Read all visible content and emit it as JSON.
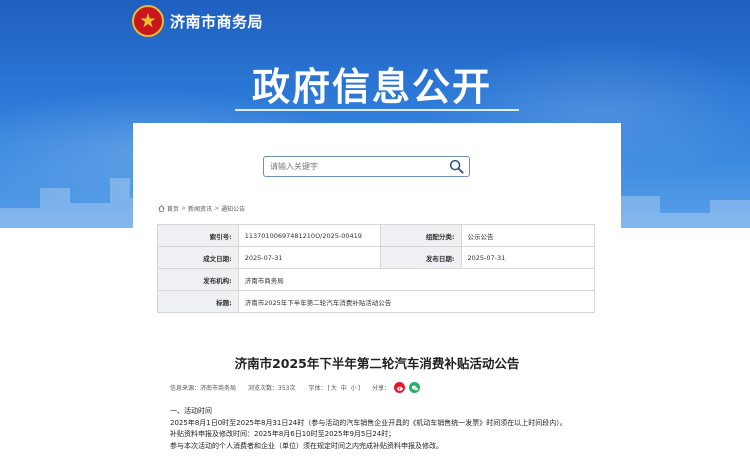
{
  "site": {
    "name": "济南市商务局",
    "banner_title": "政府信息公开"
  },
  "search": {
    "placeholder": "请输入关键字",
    "value": ""
  },
  "breadcrumb": {
    "items": [
      "首页",
      "新闻资讯",
      "通知公告"
    ]
  },
  "meta": {
    "index_label": "索引号:",
    "index_value": "11370100697481210O/2025-00419",
    "category_label": "组配分类:",
    "category_value": "公示公告",
    "created_label": "成文日期:",
    "created_value": "2025-07-31",
    "published_label": "发布日期:",
    "published_value": "2025-07-31",
    "issuer_label": "发布机构:",
    "issuer_value": "济南市商务局",
    "title_label": "标题:",
    "title_value": "济南市2025年下半年第二轮汽车消费补贴活动公告"
  },
  "article": {
    "title": "济南市2025年下半年第二轮汽车消费补贴活动公告",
    "source": "信息来源：济南市商务局",
    "views": "浏览次数：353次",
    "font_label": "字体：",
    "font_large": "大",
    "font_medium": "中",
    "font_small": "小",
    "share_label": "分享：",
    "section1": "一、活动时间",
    "para1": "2025年8月1日0时至2025年8月31日24时（参与活动的汽车销售企业开具的《机动车销售统一发票》时间须在以上时间段内）。",
    "para2": "补贴资料申报及修改时间：2025年8月6日10时至2025年9月5日24时；",
    "para3": "参与本次活动的个人消费者和企业（单位）须在规定时间之内完成补贴资料申报及修改。"
  },
  "colors": {
    "banner_blue": "#2d7ad8",
    "weibo_red": "#e6162d",
    "wechat_green": "#2aae67"
  }
}
